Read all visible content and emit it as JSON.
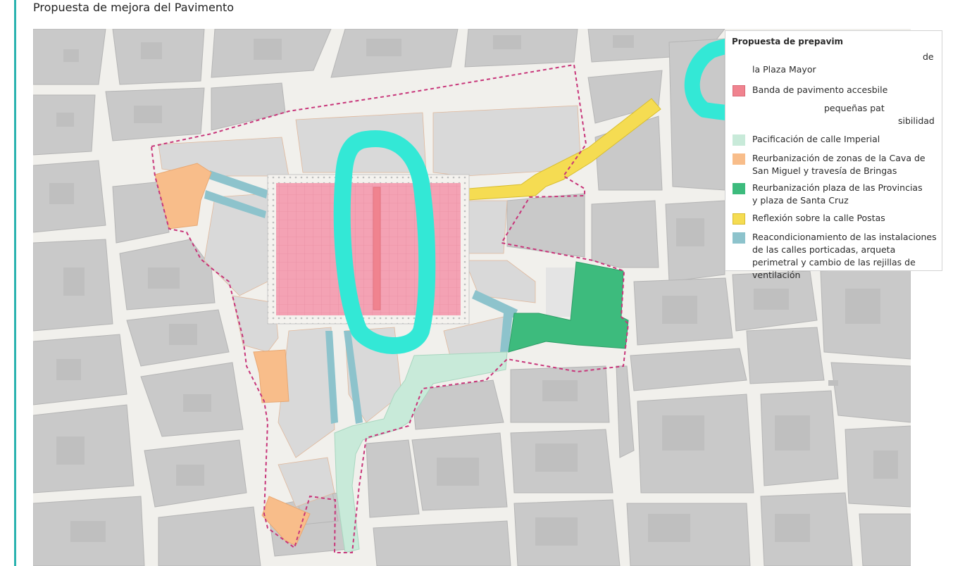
{
  "page": {
    "title": "Propuesta de mejora del Pavimento"
  },
  "legend": {
    "title": "Propuesta de prepavim",
    "items": [
      {
        "label_top": "de",
        "label_bottom": "la Plaza Mayor",
        "color": "#f2a6b6"
      },
      {
        "label": "Banda de pavimento accesbile",
        "color": "#f0838f"
      },
      {
        "label_left": "pequeñas pat",
        "label_right": "sibilidad",
        "color": "#e3d2c6"
      },
      {
        "label": "Pacificación de calle Imperial",
        "color": "#c8ead9"
      },
      {
        "label": "Reurbanización de zonas de la Cava de San Miguel y travesía de Bringas",
        "color": "#f8bd8a"
      },
      {
        "label": "Reurbanización plaza de las Provincias y plaza de Santa Cruz",
        "color": "#3dbb7d"
      },
      {
        "label": "Reflexión sobre la calle Postas",
        "color": "#f5dc52"
      },
      {
        "label": "Reacondicionamiento de las instalaciones de las calles porticadas, arqueta perimetral y cambio de las rejillas de ventilación",
        "color": "#8dc3cc"
      }
    ]
  },
  "map_colors": {
    "street": "#f1f0ec",
    "block": "#c9c9c9",
    "block_edge": "#b6b6b6",
    "inner_block": "#d9d9d9",
    "boundary": "#c8367a",
    "highlight": "#33e8d6"
  }
}
